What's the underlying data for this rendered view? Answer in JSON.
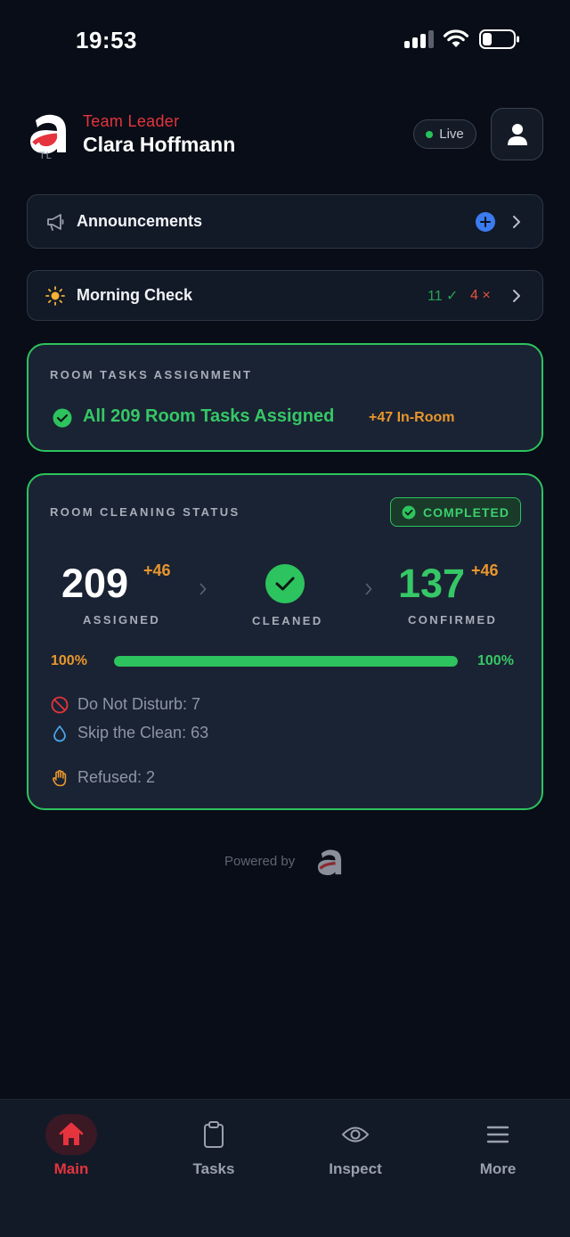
{
  "status_bar": {
    "time": "19:53"
  },
  "header": {
    "logo_badge": "TL",
    "role": "Team Leader",
    "name": "Clara Hoffmann",
    "live_label": "Live"
  },
  "announcements": {
    "label": "Announcements",
    "icon": "megaphone-icon"
  },
  "morning_check": {
    "label": "Morning Check",
    "ok_count": "11 ✓",
    "bad_count": "4 ×",
    "icon": "sun-icon"
  },
  "room_tasks": {
    "title": "ROOM TASKS ASSIGNMENT",
    "message": "All 209 Room Tasks Assigned",
    "in_room": "+47 In-Room"
  },
  "cleaning_status": {
    "title": "ROOM CLEANING STATUS",
    "badge": "COMPLETED",
    "assigned_value": "209",
    "assigned_delta": "+46",
    "assigned_label": "ASSIGNED",
    "cleaned_label": "CLEANED",
    "confirmed_value": "137",
    "confirmed_delta": "+46",
    "confirmed_label": "CONFIRMED",
    "progress_left": "100%",
    "progress_right": "100%",
    "progress_fraction": 1.0,
    "do_not_disturb": "Do Not Disturb: 7",
    "skip_clean": "Skip the Clean: 63",
    "refused": "Refused: 2"
  },
  "footer": {
    "powered_by": "Powered by"
  },
  "nav": [
    {
      "label": "Main",
      "icon": "home-icon",
      "active": true
    },
    {
      "label": "Tasks",
      "icon": "clipboard-icon",
      "active": false
    },
    {
      "label": "Inspect",
      "icon": "eye-icon",
      "active": false
    },
    {
      "label": "More",
      "icon": "menu-icon",
      "active": false
    }
  ],
  "colors": {
    "background": "#090d17",
    "accent_red": "#e5343d",
    "success_green": "#2dc35e",
    "warning_orange": "#e9962c",
    "info_blue": "#3b7bf0"
  }
}
